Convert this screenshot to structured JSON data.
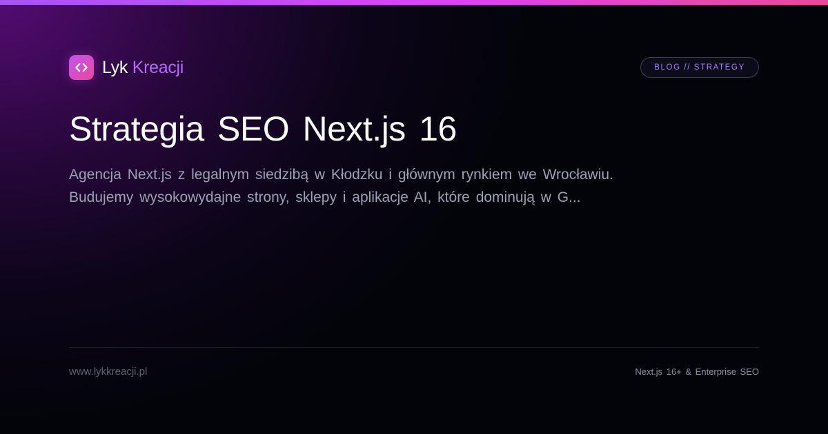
{
  "brand": {
    "name_primary": "Lyk",
    "name_accent": "Kreacji",
    "icon": "code-brackets-icon",
    "colors": {
      "accent": "#b46af5",
      "gradient_start": "#a855f7",
      "gradient_end": "#ec4899",
      "background": "#03040a"
    }
  },
  "badge": {
    "label": "BLOG // STRATEGY"
  },
  "hero": {
    "title": "Strategia SEO Next.js 16",
    "description_line1": "Agencja Next.js z legalnym siedzibą w Kłodzku i głównym rynkiem we Wrocławiu.",
    "description_line2": "Budujemy wysokowydajne strony, sklepy i aplikacje AI, które dominują w G..."
  },
  "footer": {
    "url": "www.lykkreacji.pl",
    "tagline": "Next.js 16+ & Enterprise SEO"
  }
}
